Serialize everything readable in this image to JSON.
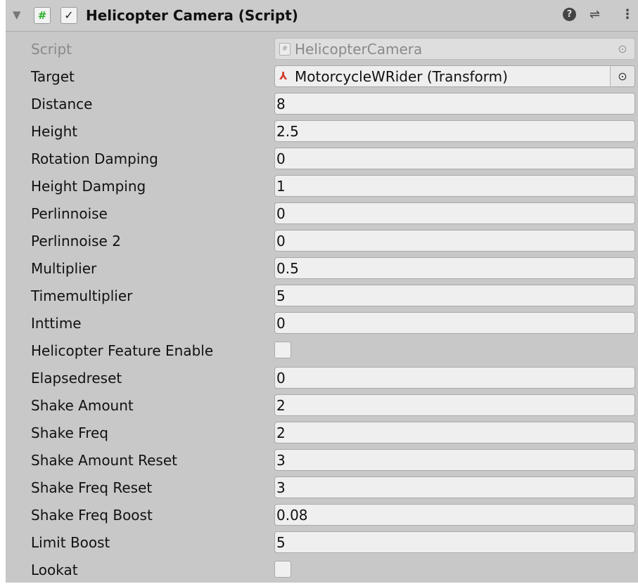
{
  "header": {
    "foldout_icon": "triangle-down-icon",
    "script_icon_glyph": "#",
    "enabled_glyph": "✓",
    "title": "Helicopter Camera (Script)",
    "help_glyph": "?",
    "presets_glyph": "⇌",
    "menu_glyph": "⋮"
  },
  "fields": {
    "script": {
      "label": "Script",
      "value": "HelicopterCamera"
    },
    "target": {
      "label": "Target",
      "value": "MotorcycleWRider (Transform)"
    },
    "distance": {
      "label": "Distance",
      "value": "8"
    },
    "height": {
      "label": "Height",
      "value": "2.5"
    },
    "rotation_damping": {
      "label": "Rotation Damping",
      "value": "0"
    },
    "height_damping": {
      "label": "Height Damping",
      "value": "1"
    },
    "perlinnoise": {
      "label": "Perlinnoise",
      "value": "0"
    },
    "perlinnoise2": {
      "label": "Perlinnoise 2",
      "value": "0"
    },
    "multiplier": {
      "label": "Multiplier",
      "value": "0.5"
    },
    "timemultiplier": {
      "label": "Timemultiplier",
      "value": "5"
    },
    "inttime": {
      "label": "Inttime",
      "value": "0"
    },
    "helicopter_feature_enable": {
      "label": "Helicopter Feature Enable",
      "checked": false
    },
    "elapsedreset": {
      "label": "Elapsedreset",
      "value": "0"
    },
    "shake_amount": {
      "label": "Shake Amount",
      "value": "2"
    },
    "shake_freq": {
      "label": "Shake Freq",
      "value": "2"
    },
    "shake_amount_reset": {
      "label": "Shake Amount Reset",
      "value": "3"
    },
    "shake_freq_reset": {
      "label": "Shake Freq Reset",
      "value": "3"
    },
    "shake_freq_boost": {
      "label": "Shake Freq Boost",
      "value": "0.08"
    },
    "limit_boost": {
      "label": "Limit Boost",
      "value": "5"
    },
    "lookat": {
      "label": "Lookat",
      "checked": false
    }
  },
  "colors": {
    "panel_bg": "#c8c8c8",
    "field_bg": "#efefef",
    "script_icon_green": "#2bb02b",
    "transform_icon_red": "#d23a2a"
  }
}
